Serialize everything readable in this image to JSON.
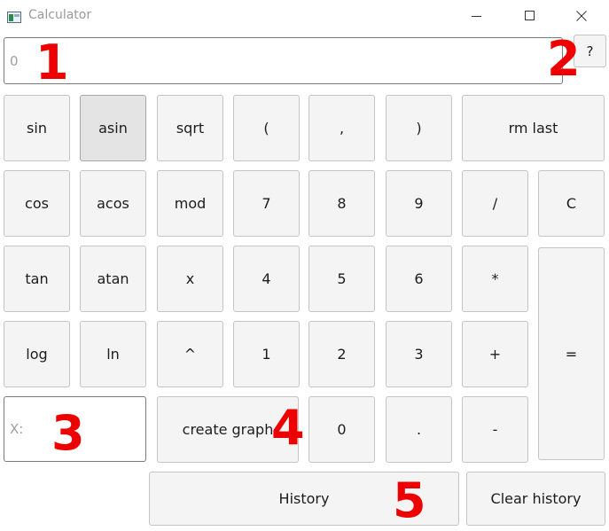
{
  "window": {
    "title": "Calculator",
    "controls": [
      "minimize-icon",
      "maximize-icon",
      "close-icon"
    ]
  },
  "display": {
    "value": "0"
  },
  "help_button": {
    "label": "?"
  },
  "keypad": {
    "row1": [
      "sin",
      "asin",
      "sqrt",
      "(",
      ",",
      ")",
      "rm last"
    ],
    "row2": [
      "cos",
      "acos",
      "mod",
      "7",
      "8",
      "9",
      "/",
      "C"
    ],
    "row3": [
      "tan",
      "atan",
      "x",
      "4",
      "5",
      "6",
      "*"
    ],
    "row4": [
      "log",
      "ln",
      "^",
      "1",
      "2",
      "3",
      "+"
    ],
    "row5": [
      "create graph",
      "0",
      ".",
      "-"
    ],
    "equals": "="
  },
  "x_input": {
    "placeholder": "X:"
  },
  "footer": {
    "history": "History",
    "clear_history": "Clear history"
  },
  "annotations": [
    "1",
    "2",
    "3",
    "4",
    "5"
  ],
  "colors": {
    "annotation": "#ee0000",
    "button_bg": "#f4f4f4",
    "button_pressed": "#e4e4e4"
  }
}
